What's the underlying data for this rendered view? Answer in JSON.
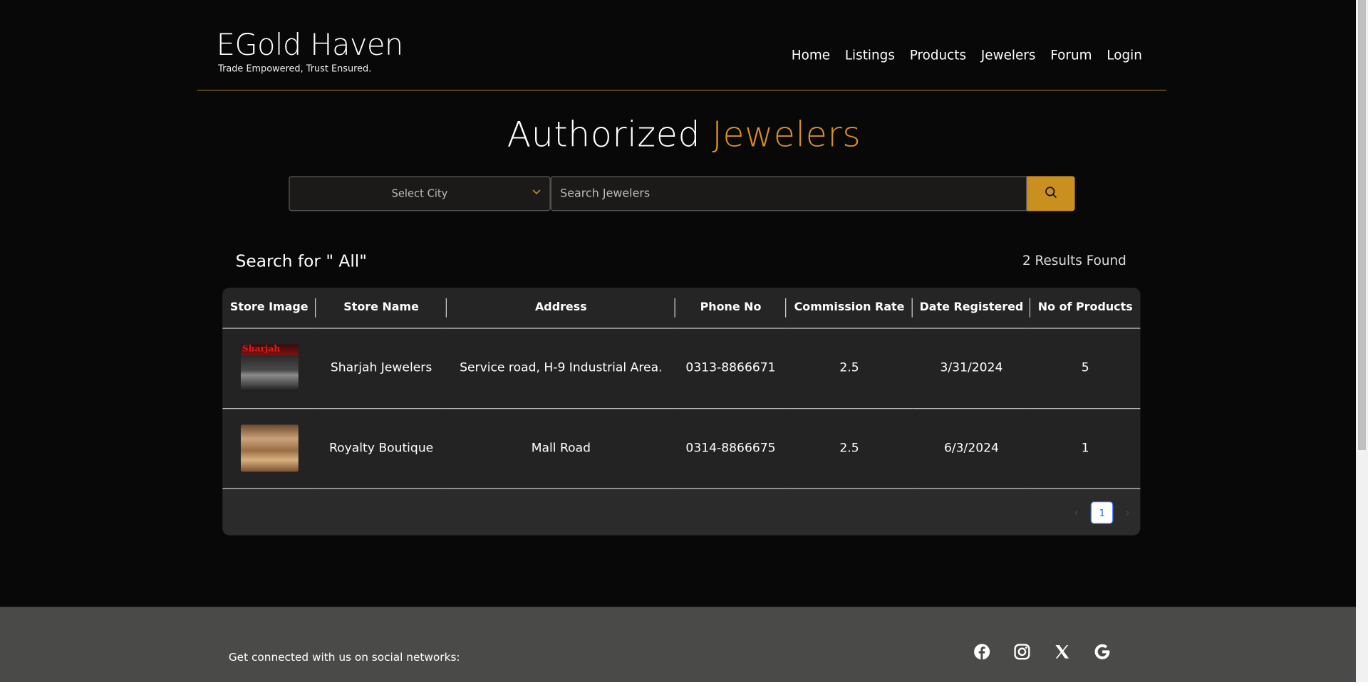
{
  "brand": {
    "title": "EGold Haven",
    "tagline": "Trade Empowered, Trust Ensured."
  },
  "nav": [
    "Home",
    "Listings",
    "Products",
    "Jewelers",
    "Forum",
    "Login"
  ],
  "page_title": {
    "main": "Authorized",
    "accent": "Jewelers"
  },
  "search": {
    "city_placeholder": "Select City",
    "input_placeholder": "Search Jewelers"
  },
  "results": {
    "search_for": "Search for \" All\"",
    "count_text": "2 Results Found"
  },
  "table": {
    "headers": [
      "Store Image",
      "Store Name",
      "Address",
      "Phone No",
      "Commission Rate",
      "Date Registered",
      "No of Products"
    ],
    "rows": [
      {
        "image_label": "Sharjah",
        "store_name": "Sharjah Jewelers",
        "address": "Service road, H-9 Industrial Area.",
        "phone": "0313-8866671",
        "commission": "2.5",
        "date": "3/31/2024",
        "products": "5"
      },
      {
        "image_label": "",
        "store_name": "Royalty Boutique",
        "address": "Mall Road",
        "phone": "0314-8866675",
        "commission": "2.5",
        "date": "6/3/2024",
        "products": "1"
      }
    ]
  },
  "pagination": {
    "current_page": "1",
    "prev": "‹",
    "next": "›"
  },
  "footer": {
    "text": "Get connected with us on social networks:",
    "icons": [
      "facebook-icon",
      "instagram-icon",
      "x-icon",
      "google-icon"
    ]
  },
  "colors": {
    "accent": "#d98e23",
    "button": "#c99020",
    "background": "#080808",
    "footer": "#4a4b48"
  }
}
